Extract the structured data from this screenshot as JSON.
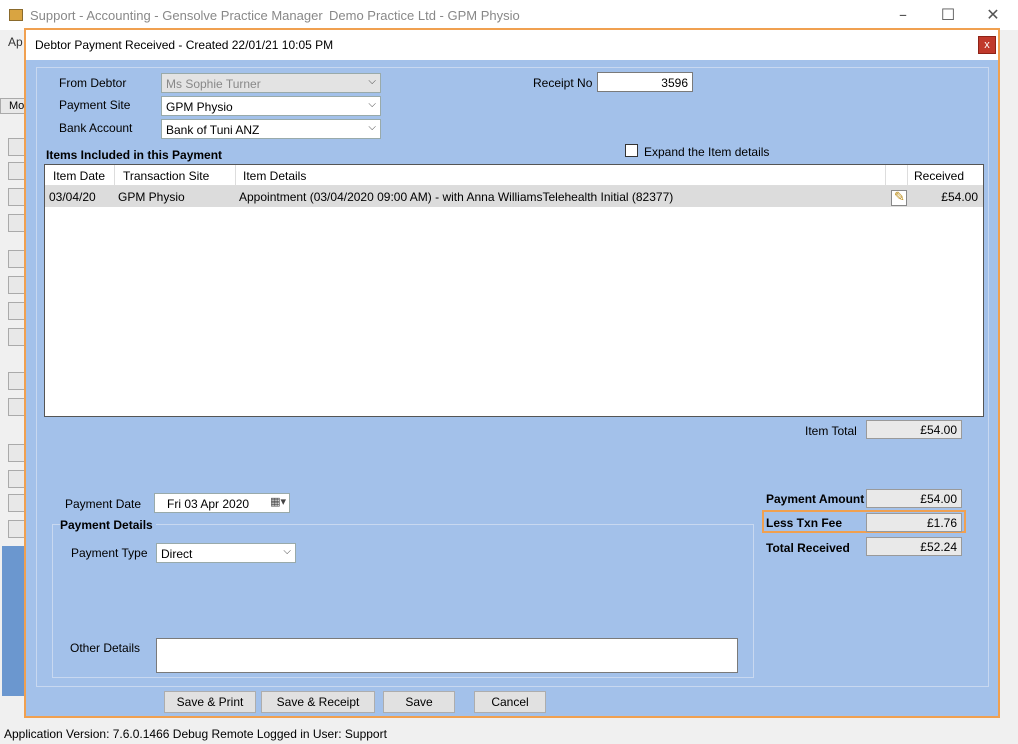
{
  "outer": {
    "title": "Support - Accounting - Gensolve Practice Manager",
    "subtitle": "Demo Practice Ltd - GPM Physio",
    "menu_fragment": "Ap",
    "tab_fragment": "Mo"
  },
  "status_bar": "Application Version: 7.6.0.1466 Debug Remote  Logged in User: Support",
  "dialog": {
    "title": "Debtor Payment Received - Created 22/01/21 10:05 PM",
    "close_label": "x",
    "from_debtor_label": "From Debtor",
    "from_debtor_value": "Ms Sophie Turner",
    "payment_site_label": "Payment Site",
    "payment_site_value": "GPM Physio",
    "bank_account_label": "Bank Account",
    "bank_account_value": "Bank of Tuni ANZ",
    "receipt_no_label": "Receipt No",
    "receipt_no_value": "3596",
    "items_heading": "Items Included in this Payment",
    "expand_label": "Expand the Item details",
    "grid": {
      "columns": [
        "Item Date",
        "Transaction Site",
        "Item Details",
        "",
        "Received"
      ],
      "rows": [
        {
          "date": "03/04/20",
          "site": "GPM Physio",
          "details": "Appointment (03/04/2020 09:00 AM) -  with Anna WilliamsTelehealth Initial (82377)",
          "received": "£54.00"
        }
      ]
    },
    "item_total_label": "Item Total",
    "item_total_value": "£54.00",
    "payment_date_label": "Payment Date",
    "payment_date_value": "Fri   03  Apr  2020",
    "payment_details_heading": "Payment Details",
    "payment_type_label": "Payment Type",
    "payment_type_value": "Direct",
    "other_details_label": "Other Details",
    "other_details_value": "",
    "payment_amount_label": "Payment Amount",
    "payment_amount_value": "£54.00",
    "txn_fee_label": "Less Txn Fee",
    "txn_fee_value": "£1.76",
    "total_received_label": "Total Received",
    "total_received_value": "£52.24",
    "buttons": {
      "save_print": "Save & Print",
      "save_receipt": "Save & Receipt",
      "save": "Save",
      "cancel": "Cancel"
    }
  },
  "colors": {
    "dialog_bg": "#a3c1ea",
    "highlight": "#f0a050",
    "close_btn": "#c0392b"
  }
}
